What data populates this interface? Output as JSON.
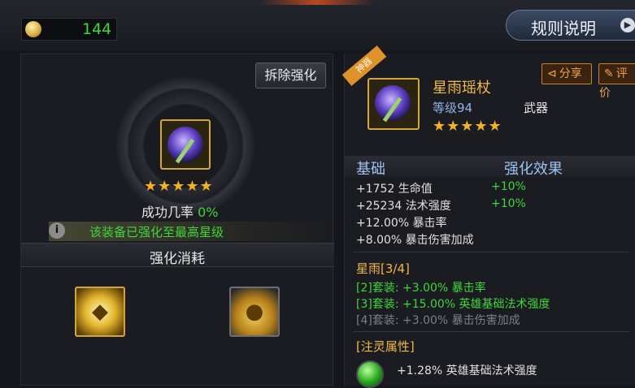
{
  "currency": {
    "icon": "coin-icon",
    "value": "144"
  },
  "header": {
    "rules_label": "规则说明"
  },
  "enhance": {
    "remove_label": "拆除强化",
    "stars": "★★★★★",
    "rate_label": "成功几率 ",
    "rate_value": "0%",
    "max_message": "该装备已强化至最高星级",
    "cost_title": "强化消耗",
    "cost_items": [
      {
        "icon": "enhance-stone-icon"
      },
      {
        "icon": "gold-coins-icon"
      }
    ]
  },
  "item": {
    "tag": "神器",
    "name": "星雨瑶杖",
    "level": "等级94",
    "type": "武器",
    "stars": "★★★★★",
    "share_label": "分享",
    "rate_label": "评价"
  },
  "stats": {
    "base_header": "基础",
    "effect_header": "强化效果",
    "base": [
      {
        "text": "+1752 生命值",
        "bonus": "+10%"
      },
      {
        "text": "+25234 法术强度",
        "bonus": "+10%"
      },
      {
        "text": "+12.00% 暴击率",
        "bonus": ""
      },
      {
        "text": "+8.00% 暴击伤害加成",
        "bonus": ""
      }
    ]
  },
  "set": {
    "title": "星雨[3/4]",
    "lines": [
      {
        "text": "[2]套装: +3.00% 暴击率",
        "active": true
      },
      {
        "text": "[3]套装: +15.00% 英雄基础法术强度",
        "active": true
      },
      {
        "text": "[4]套装: +3.00% 暴击伤害加成",
        "active": false
      }
    ]
  },
  "spirit": {
    "title": "[注灵属性]",
    "stat": "+1.28% 英雄基础法术强度"
  },
  "colors": {
    "green": "#3fd63a",
    "gold": "#f1b84a",
    "blue": "#9cc2f2"
  }
}
